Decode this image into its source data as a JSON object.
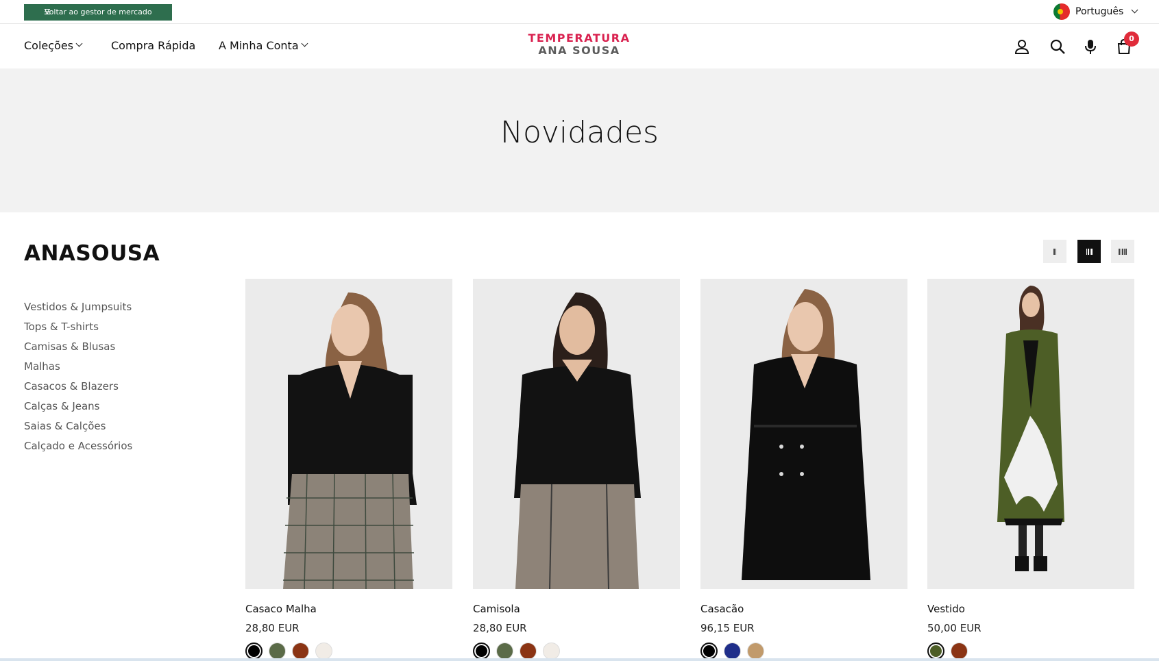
{
  "topbar": {
    "back_label": "Voltar ao gestor de mercado",
    "language": "Português"
  },
  "header": {
    "nav": [
      "Coleções",
      "Compra Rápida",
      "A Minha Conta"
    ],
    "logo_line1": "TEMPERATURA",
    "logo_line2": "ANA SOUSA",
    "cart_count": "0",
    "icons": [
      "user-icon",
      "search-icon",
      "microphone-icon",
      "cart-icon"
    ]
  },
  "hero": {
    "title": "Novidades"
  },
  "brand": "ANASOUSA",
  "sidebar": {
    "items": [
      "Vestidos & Jumpsuits",
      "Tops & T-shirts",
      "Camisas & Blusas",
      "Malhas",
      "Casacos & Blazers",
      "Calças & Jeans",
      "Saias & Calções",
      "Calçado e Acessórios"
    ]
  },
  "grid_options": [
    "2-columns",
    "4-columns",
    "5-columns"
  ],
  "products": [
    {
      "name": "Casaco Malha",
      "price": "28,80 EUR",
      "swatches": [
        "#000000",
        "#5b6b48",
        "#8b3414",
        "#f1ece6"
      ]
    },
    {
      "name": "Camisola",
      "price": "28,80 EUR",
      "swatches": [
        "#000000",
        "#5b6b48",
        "#8b3414",
        "#f1ece6"
      ]
    },
    {
      "name": "Casacão",
      "price": "96,15 EUR",
      "swatches": [
        "#000000",
        "#1f2e8a",
        "#c19a6b"
      ]
    },
    {
      "name": "Vestido",
      "price": "50,00 EUR",
      "swatches": [
        "#4d5e26",
        "#8b3414"
      ]
    }
  ],
  "colors": {
    "accent_green": "#2e6e4e",
    "brand_red": "#d9214f",
    "badge_red": "#e02b3a"
  }
}
